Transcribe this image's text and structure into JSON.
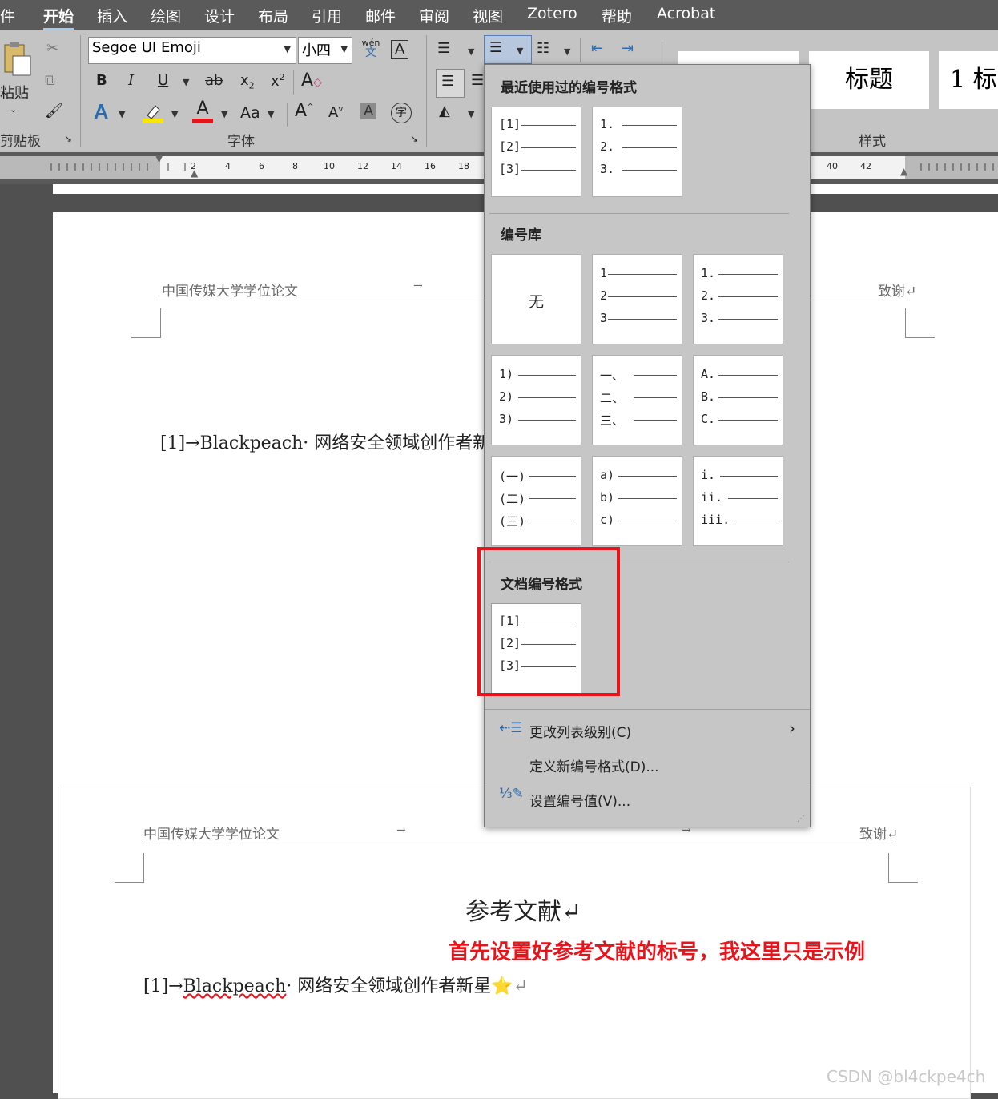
{
  "menubar": {
    "items": [
      "件",
      "开始",
      "插入",
      "绘图",
      "设计",
      "布局",
      "引用",
      "邮件",
      "审阅",
      "视图",
      "Zotero",
      "帮助",
      "Acrobat"
    ],
    "active": "开始"
  },
  "ribbon": {
    "paste_label": "粘贴",
    "clipboard_label": "剪贴板",
    "font_group_label": "字体",
    "styles_group_label": "样式",
    "font_name": "Segoe UI Emoji",
    "font_size": "小四",
    "phonetic_top": "wén",
    "phonetic_bottom": "文",
    "boxed_a": "A",
    "bold": "B",
    "italic": "I",
    "underline": "U",
    "strike": "ab",
    "subscript": "x",
    "subscript_mark": "2",
    "superscript": "x",
    "superscript_mark": "2",
    "change_case": "Aa",
    "grow_font": "A",
    "shrink_font": "A",
    "char_shading": "A",
    "enclose_char": "字",
    "style_title": "标题",
    "style_heading1": "1  标",
    "highlight_color": "#f5e50a",
    "font_color": "#e8141b"
  },
  "ruler": {
    "numbers": [
      "2",
      "4",
      "6",
      "8",
      "10",
      "12",
      "14",
      "16",
      "18",
      "40",
      "42"
    ]
  },
  "page1": {
    "header_left": "中国传媒大学学位论文",
    "header_arrow": "→",
    "header_right": "致谢↵",
    "body_line": "[1]→Blackpeach· 网络安全领域创作者新"
  },
  "page2": {
    "header_left": "中国传媒大学学位论文",
    "header_arrow1": "→",
    "header_arrow2": "→",
    "header_right": "致谢↵",
    "title": "参考文献↵",
    "body_prefix": "[1]→",
    "body_name": "Blackpeach",
    "body_rest": "· 网络安全领域创作者新星",
    "star": "⭐",
    "para_mark": "↵"
  },
  "numbering_menu": {
    "recent_title": "最近使用过的编号格式",
    "library_title": "编号库",
    "document_title": "文档编号格式",
    "recent": [
      [
        "[1]",
        "[2]",
        "[3]"
      ],
      [
        "1.",
        "2.",
        "3."
      ]
    ],
    "library": [
      {
        "none": "无"
      },
      {
        "rows": [
          "1",
          "2",
          "3"
        ]
      },
      {
        "rows": [
          "1.",
          "2.",
          "3."
        ]
      },
      {
        "rows": [
          "1)",
          "2)",
          "3)"
        ]
      },
      {
        "rows": [
          "一、",
          "二、",
          "三、"
        ]
      },
      {
        "rows": [
          "A.",
          "B.",
          "C."
        ]
      },
      {
        "rows": [
          "(一)",
          "(二)",
          "(三)"
        ]
      },
      {
        "rows": [
          "a)",
          "b)",
          "c)"
        ]
      },
      {
        "rows": [
          "i.",
          "ii.",
          "iii."
        ]
      }
    ],
    "document": [
      [
        "[1]",
        "[2]",
        "[3]"
      ]
    ],
    "change_level": "更改列表级别(C)",
    "define_new": "定义新编号格式(D)...",
    "set_value": "设置编号值(V)..."
  },
  "annotation": "首先设置好参考文献的标号，我这里只是示例",
  "watermark": "CSDN @bl4ckpe4ch"
}
